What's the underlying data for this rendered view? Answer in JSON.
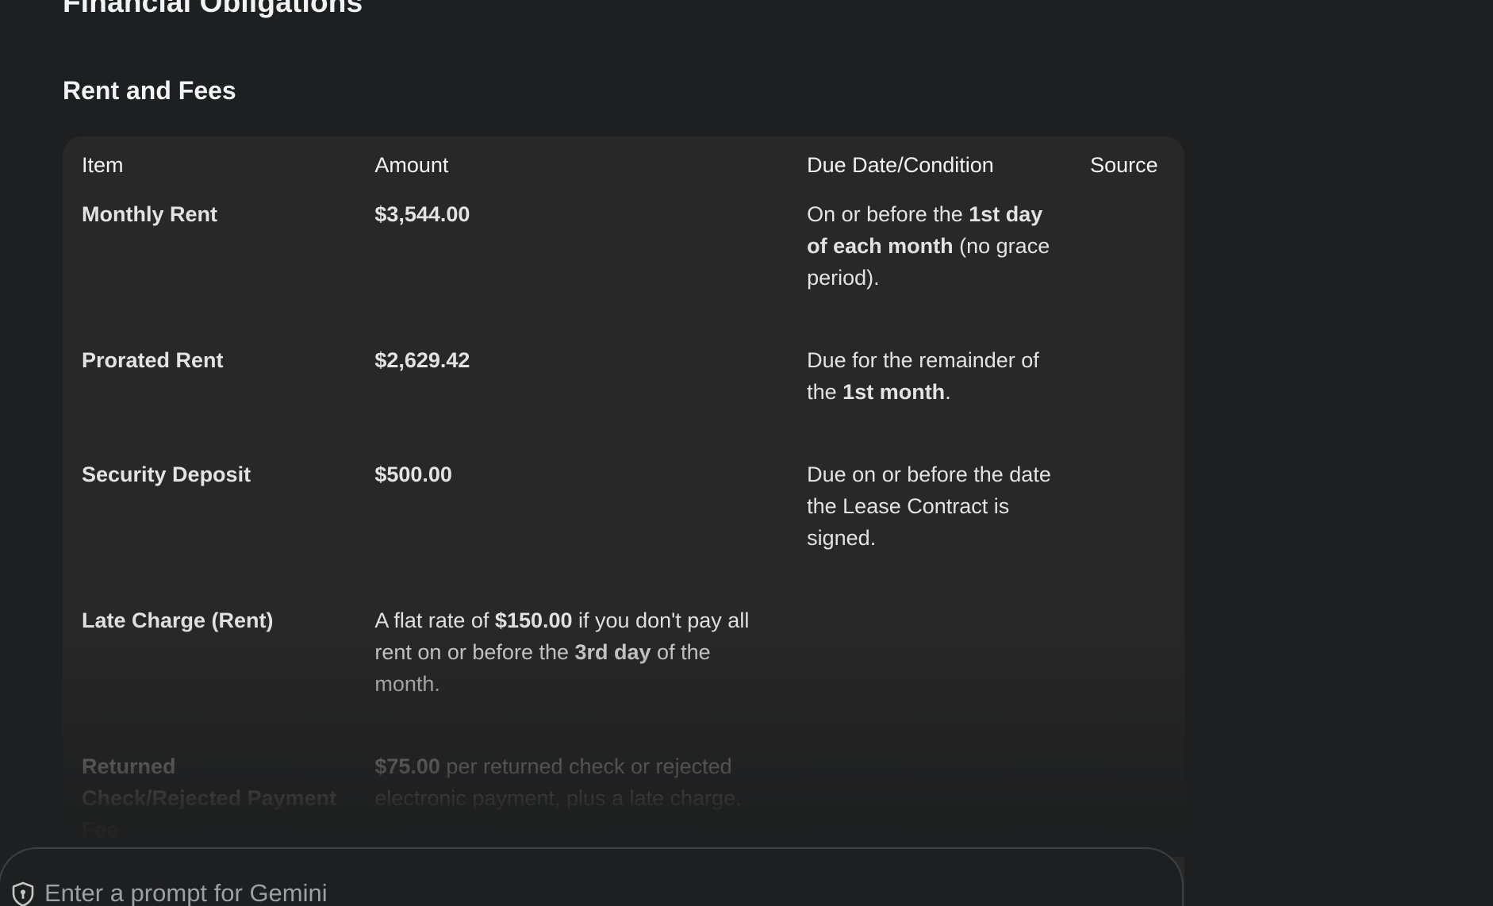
{
  "section_title": "Financial Obligations",
  "subsection_title": "Rent and Fees",
  "table": {
    "headers": [
      "Item",
      "Amount",
      "Due Date/Condition",
      "Source"
    ],
    "rows": [
      {
        "item": "Monthly Rent",
        "amount": "$3,544.00",
        "due_parts": [
          "On or before the ",
          "1st day of each month",
          " (no grace period)."
        ],
        "source": ""
      },
      {
        "item": "Prorated Rent",
        "amount": "$2,629.42",
        "due_parts": [
          "Due for the remainder of the ",
          "1st month",
          "."
        ],
        "source": ""
      },
      {
        "item": "Security Deposit",
        "amount": "$500.00",
        "due": "Due on or before the date the Lease Contract is signed.",
        "source": ""
      },
      {
        "item": "Late Charge (Rent)",
        "amount_parts": [
          "A flat rate of ",
          "$150.00",
          " if you don't pay all rent on or before the ",
          "3rd day",
          " of the month."
        ],
        "due": "",
        "source": ""
      },
      {
        "item": "Returned Check/Rejected Payment Fee",
        "amount_parts": [
          "$75.00",
          " per returned check or rejected electronic payment, plus a late charge."
        ],
        "due": "",
        "source": ""
      }
    ]
  },
  "prompt": {
    "placeholder": "Enter a prompt for Gemini",
    "value": "",
    "icon": "shield-icon"
  }
}
